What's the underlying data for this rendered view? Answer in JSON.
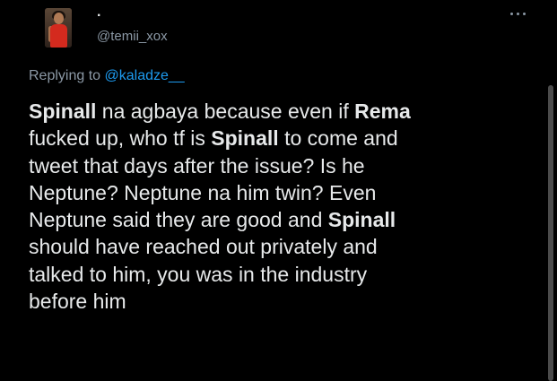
{
  "tweet": {
    "display_name": ".",
    "username": "@temii_xox",
    "replying_label": "Replying to",
    "replying_to": "@kaladze__",
    "text_lines": [
      [
        {
          "t": "Spinall",
          "b": true
        },
        {
          "t": " na agbaya because even if ",
          "b": false
        },
        {
          "t": "Rema",
          "b": true
        }
      ],
      [
        {
          "t": "fucked up, who tf is ",
          "b": false
        },
        {
          "t": "Spinall",
          "b": true
        },
        {
          "t": " to come and",
          "b": false
        }
      ],
      [
        {
          "t": "tweet that days after the issue? Is he",
          "b": false
        }
      ],
      [
        {
          "t": "Neptune? Neptune na him twin? Even",
          "b": false
        }
      ],
      [
        {
          "t": "Neptune said they are good and ",
          "b": false
        },
        {
          "t": "Spinall",
          "b": true
        }
      ],
      [
        {
          "t": "should have reached out privately and",
          "b": false
        }
      ],
      [
        {
          "t": "talked to him, you was in the industry",
          "b": false
        }
      ],
      [
        {
          "t": "before him",
          "b": false
        }
      ]
    ]
  },
  "icons": {
    "more": "more-horizontal-icon"
  },
  "colors": {
    "background": "#000000",
    "text": "#e7e9ea",
    "muted": "#8b98a5",
    "link": "#1d9bf0"
  }
}
